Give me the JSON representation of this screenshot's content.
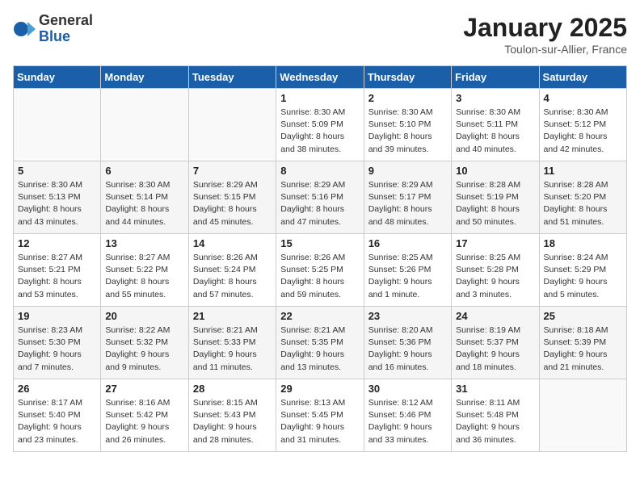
{
  "logo": {
    "general": "General",
    "blue": "Blue"
  },
  "title": "January 2025",
  "location": "Toulon-sur-Allier, France",
  "weekdays": [
    "Sunday",
    "Monday",
    "Tuesday",
    "Wednesday",
    "Thursday",
    "Friday",
    "Saturday"
  ],
  "weeks": [
    [
      {
        "day": "",
        "info": ""
      },
      {
        "day": "",
        "info": ""
      },
      {
        "day": "",
        "info": ""
      },
      {
        "day": "1",
        "info": "Sunrise: 8:30 AM\nSunset: 5:09 PM\nDaylight: 8 hours\nand 38 minutes."
      },
      {
        "day": "2",
        "info": "Sunrise: 8:30 AM\nSunset: 5:10 PM\nDaylight: 8 hours\nand 39 minutes."
      },
      {
        "day": "3",
        "info": "Sunrise: 8:30 AM\nSunset: 5:11 PM\nDaylight: 8 hours\nand 40 minutes."
      },
      {
        "day": "4",
        "info": "Sunrise: 8:30 AM\nSunset: 5:12 PM\nDaylight: 8 hours\nand 42 minutes."
      }
    ],
    [
      {
        "day": "5",
        "info": "Sunrise: 8:30 AM\nSunset: 5:13 PM\nDaylight: 8 hours\nand 43 minutes."
      },
      {
        "day": "6",
        "info": "Sunrise: 8:30 AM\nSunset: 5:14 PM\nDaylight: 8 hours\nand 44 minutes."
      },
      {
        "day": "7",
        "info": "Sunrise: 8:29 AM\nSunset: 5:15 PM\nDaylight: 8 hours\nand 45 minutes."
      },
      {
        "day": "8",
        "info": "Sunrise: 8:29 AM\nSunset: 5:16 PM\nDaylight: 8 hours\nand 47 minutes."
      },
      {
        "day": "9",
        "info": "Sunrise: 8:29 AM\nSunset: 5:17 PM\nDaylight: 8 hours\nand 48 minutes."
      },
      {
        "day": "10",
        "info": "Sunrise: 8:28 AM\nSunset: 5:19 PM\nDaylight: 8 hours\nand 50 minutes."
      },
      {
        "day": "11",
        "info": "Sunrise: 8:28 AM\nSunset: 5:20 PM\nDaylight: 8 hours\nand 51 minutes."
      }
    ],
    [
      {
        "day": "12",
        "info": "Sunrise: 8:27 AM\nSunset: 5:21 PM\nDaylight: 8 hours\nand 53 minutes."
      },
      {
        "day": "13",
        "info": "Sunrise: 8:27 AM\nSunset: 5:22 PM\nDaylight: 8 hours\nand 55 minutes."
      },
      {
        "day": "14",
        "info": "Sunrise: 8:26 AM\nSunset: 5:24 PM\nDaylight: 8 hours\nand 57 minutes."
      },
      {
        "day": "15",
        "info": "Sunrise: 8:26 AM\nSunset: 5:25 PM\nDaylight: 8 hours\nand 59 minutes."
      },
      {
        "day": "16",
        "info": "Sunrise: 8:25 AM\nSunset: 5:26 PM\nDaylight: 9 hours\nand 1 minute."
      },
      {
        "day": "17",
        "info": "Sunrise: 8:25 AM\nSunset: 5:28 PM\nDaylight: 9 hours\nand 3 minutes."
      },
      {
        "day": "18",
        "info": "Sunrise: 8:24 AM\nSunset: 5:29 PM\nDaylight: 9 hours\nand 5 minutes."
      }
    ],
    [
      {
        "day": "19",
        "info": "Sunrise: 8:23 AM\nSunset: 5:30 PM\nDaylight: 9 hours\nand 7 minutes."
      },
      {
        "day": "20",
        "info": "Sunrise: 8:22 AM\nSunset: 5:32 PM\nDaylight: 9 hours\nand 9 minutes."
      },
      {
        "day": "21",
        "info": "Sunrise: 8:21 AM\nSunset: 5:33 PM\nDaylight: 9 hours\nand 11 minutes."
      },
      {
        "day": "22",
        "info": "Sunrise: 8:21 AM\nSunset: 5:35 PM\nDaylight: 9 hours\nand 13 minutes."
      },
      {
        "day": "23",
        "info": "Sunrise: 8:20 AM\nSunset: 5:36 PM\nDaylight: 9 hours\nand 16 minutes."
      },
      {
        "day": "24",
        "info": "Sunrise: 8:19 AM\nSunset: 5:37 PM\nDaylight: 9 hours\nand 18 minutes."
      },
      {
        "day": "25",
        "info": "Sunrise: 8:18 AM\nSunset: 5:39 PM\nDaylight: 9 hours\nand 21 minutes."
      }
    ],
    [
      {
        "day": "26",
        "info": "Sunrise: 8:17 AM\nSunset: 5:40 PM\nDaylight: 9 hours\nand 23 minutes."
      },
      {
        "day": "27",
        "info": "Sunrise: 8:16 AM\nSunset: 5:42 PM\nDaylight: 9 hours\nand 26 minutes."
      },
      {
        "day": "28",
        "info": "Sunrise: 8:15 AM\nSunset: 5:43 PM\nDaylight: 9 hours\nand 28 minutes."
      },
      {
        "day": "29",
        "info": "Sunrise: 8:13 AM\nSunset: 5:45 PM\nDaylight: 9 hours\nand 31 minutes."
      },
      {
        "day": "30",
        "info": "Sunrise: 8:12 AM\nSunset: 5:46 PM\nDaylight: 9 hours\nand 33 minutes."
      },
      {
        "day": "31",
        "info": "Sunrise: 8:11 AM\nSunset: 5:48 PM\nDaylight: 9 hours\nand 36 minutes."
      },
      {
        "day": "",
        "info": ""
      }
    ]
  ]
}
